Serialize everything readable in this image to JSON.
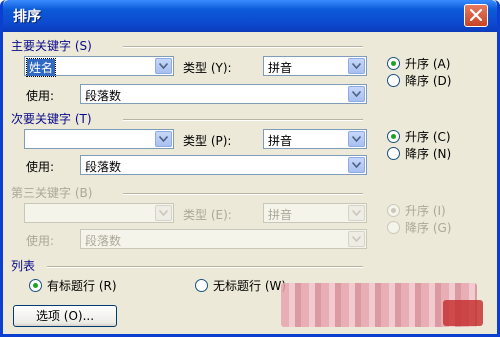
{
  "window": {
    "title": "排序"
  },
  "primary_key": {
    "group_label": "主要关键字 (S)",
    "field_value": "姓名",
    "type_label": "类型 (Y):",
    "type_value": "拼音",
    "use_label": "使用:",
    "use_value": "段落数",
    "ascending": "升序 (A)",
    "descending": "降序 (D)"
  },
  "secondary_key": {
    "group_label": "次要关键字 (T)",
    "field_value": "",
    "type_label": "类型 (P):",
    "type_value": "拼音",
    "use_label": "使用:",
    "use_value": "段落数",
    "ascending": "升序 (C)",
    "descending": "降序 (N)"
  },
  "tertiary_key": {
    "group_label": "第三关键字 (B)",
    "field_value": "",
    "type_label": "类型 (E):",
    "type_value": "拼音",
    "use_label": "使用:",
    "use_value": "段落数",
    "ascending": "升序 (I)",
    "descending": "降序 (G)"
  },
  "list": {
    "group_label": "列表",
    "header_row": "有标题行 (R)",
    "no_header_row": "无标题行 (W)"
  },
  "buttons": {
    "options": "选项 (O)..."
  },
  "colors": {
    "title_bar": "#0d4bd0",
    "dialog_bg": "#ece9d8",
    "selection": "#316ac5"
  }
}
